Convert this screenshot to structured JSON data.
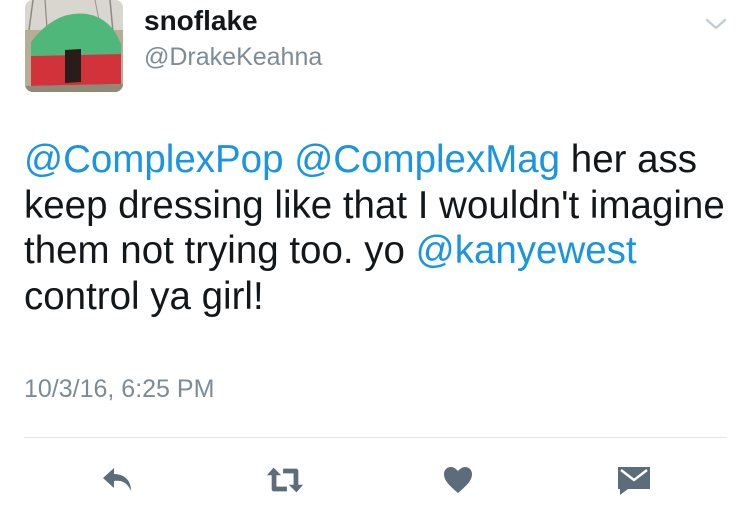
{
  "user": {
    "display_name": "snoflake",
    "handle": "@DrakeKeahna",
    "avatar_icon": "tent-avatar"
  },
  "tweet": {
    "segments": [
      {
        "text": "@ComplexPop",
        "type": "mention"
      },
      {
        "text": " ",
        "type": "text"
      },
      {
        "text": "@ComplexMag",
        "type": "mention"
      },
      {
        "text": " her ass keep dressing like that I wouldn't imagine them not trying too. yo ",
        "type": "text"
      },
      {
        "text": "@kanyewest",
        "type": "mention"
      },
      {
        "text": " control ya girl!",
        "type": "text"
      }
    ],
    "timestamp": "10/3/16, 6:25 PM"
  },
  "actions": [
    {
      "name": "reply-icon"
    },
    {
      "name": "retweet-icon"
    },
    {
      "name": "like-icon"
    },
    {
      "name": "direct-message-icon"
    }
  ],
  "colors": {
    "mention": "#1b95e0",
    "text": "#14171a",
    "secondary": "#7d8b97",
    "icon": "#5c6c7a",
    "divider": "#e1e8ed"
  }
}
